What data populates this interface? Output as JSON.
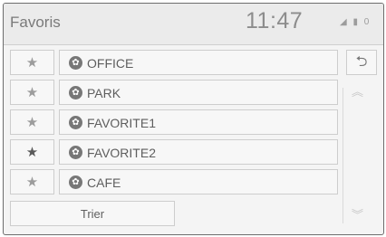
{
  "header": {
    "title": "Favoris",
    "clock": "11:47",
    "status_icons": [
      "signal-icon",
      "battery-icon",
      "info-icon"
    ],
    "status_glyphs": [
      "◢",
      "▮",
      "0"
    ]
  },
  "list": {
    "items": [
      {
        "label": "OFFICE",
        "favorite_marked": false
      },
      {
        "label": "PARK",
        "favorite_marked": false
      },
      {
        "label": "FAVORITE1",
        "favorite_marked": false
      },
      {
        "label": "FAVORITE2",
        "favorite_marked": true
      },
      {
        "label": "CAFE",
        "favorite_marked": false
      }
    ],
    "star_glyph": "★",
    "item_icon_glyph": "✿"
  },
  "buttons": {
    "sort_label": "Trier",
    "back_glyph": "⮌"
  },
  "scroll": {
    "up_glyph": "︽",
    "down_glyph": "︾"
  },
  "colors": {
    "background": "#f4f4f4",
    "header": "#ebebeb",
    "button": "#f7f7f7",
    "border": "#cdcdcd",
    "star_inactive": "#9c9c9c",
    "star_active": "#5a5a5a"
  }
}
